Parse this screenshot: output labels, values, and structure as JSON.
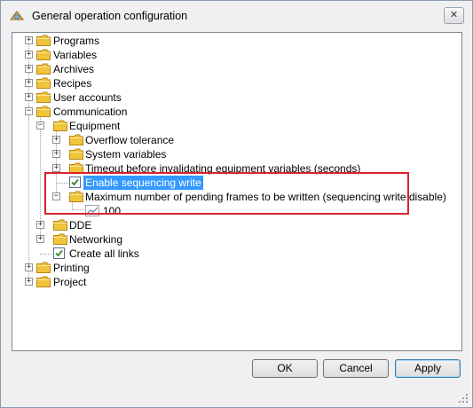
{
  "window": {
    "title": "General operation configuration",
    "close_glyph": "✕"
  },
  "tree": {
    "programs": "Programs",
    "variables": "Variables",
    "archives": "Archives",
    "recipes": "Recipes",
    "user_accounts": "User accounts",
    "communication": "Communication",
    "equipment": "Equipment",
    "overflow_tolerance": "Overflow tolerance",
    "system_variables": "System variables",
    "timeout": "Timeout before invalidating equipment variables (seconds)",
    "enable_sequencing_write": "Enable sequencing write",
    "max_pending_frames": "Maximum number of pending frames to be written (sequencing write disable)",
    "max_pending_frames_value": "100",
    "dde": "DDE",
    "networking": "Networking",
    "create_all_links": "Create all links",
    "printing": "Printing",
    "project": "Project"
  },
  "buttons": {
    "ok": "OK",
    "cancel": "Cancel",
    "apply": "Apply"
  },
  "colors": {
    "selection": "#3399ff",
    "highlight_box": "#d9232d",
    "folder": "#f0c53a"
  },
  "icons": {
    "folder": "folder-icon",
    "check": "checkbox-icon",
    "value": "value-icon",
    "app": "app-icon"
  }
}
